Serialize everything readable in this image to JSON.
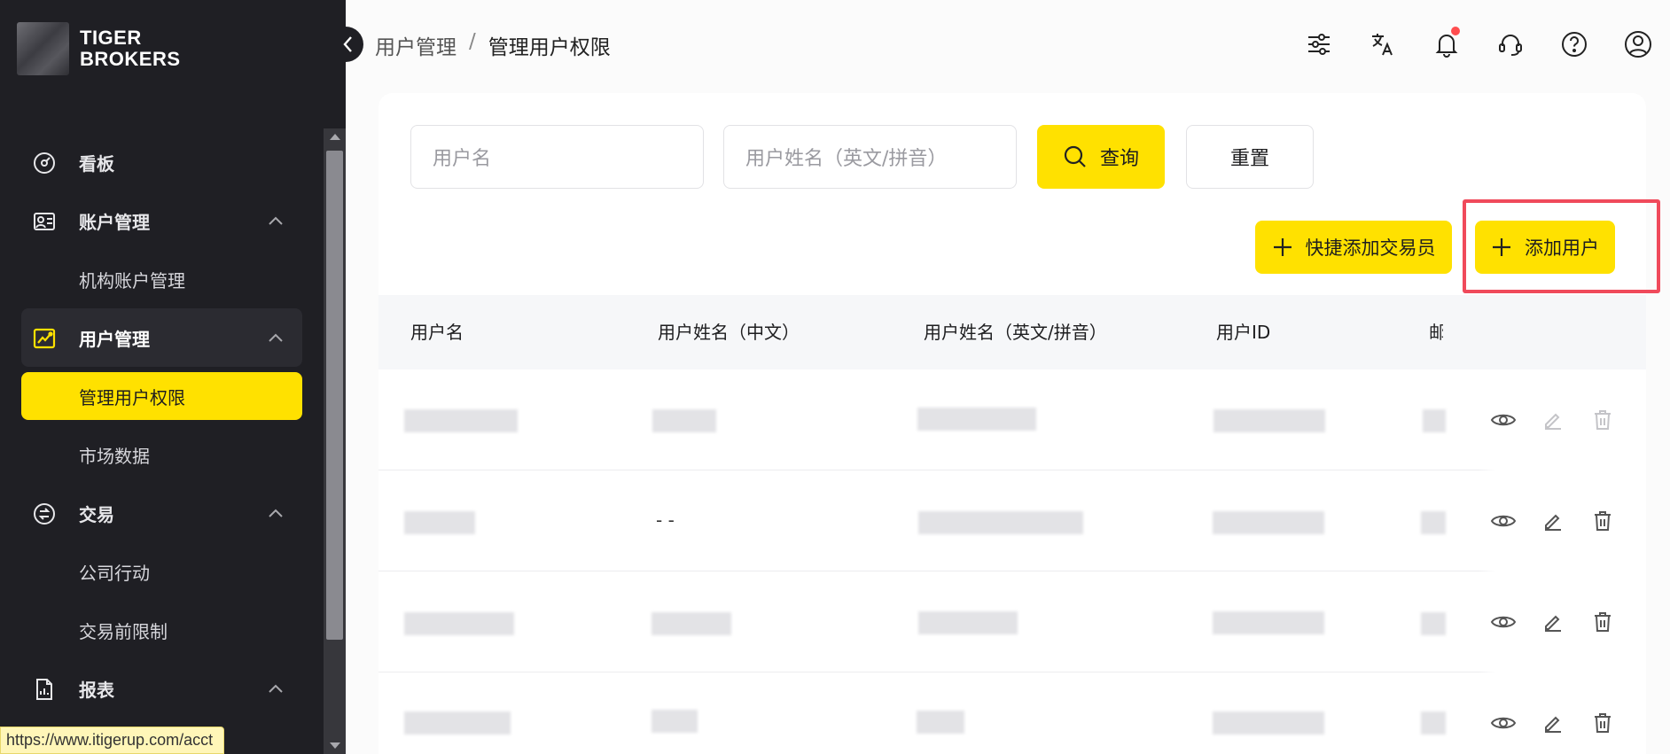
{
  "app": {
    "logo_line1": "TIGER",
    "logo_line2": "BROKERS"
  },
  "sidebar": {
    "items": [
      {
        "label": "看板",
        "icon": "dashboard-icon"
      },
      {
        "label": "账户管理",
        "icon": "account-icon"
      },
      {
        "label": "机构账户管理"
      },
      {
        "label": "用户管理",
        "icon": "user-manage-icon"
      },
      {
        "label": "管理用户权限"
      },
      {
        "label": "市场数据"
      },
      {
        "label": "交易",
        "icon": "trade-icon"
      },
      {
        "label": "公司行动"
      },
      {
        "label": "交易前限制"
      },
      {
        "label": "报表",
        "icon": "report-icon"
      }
    ]
  },
  "status_url": "https://www.itigerup.com/acct",
  "breadcrumb": {
    "parent": "用户管理",
    "separator": "/",
    "current": "管理用户权限"
  },
  "search": {
    "username_placeholder": "用户名",
    "name_en_placeholder": "用户姓名（英文/拼音）",
    "query_label": "查询",
    "reset_label": "重置"
  },
  "toolbar": {
    "quick_add_trader": "快捷添加交易员",
    "add_user": "添加用户"
  },
  "table": {
    "columns": [
      "用户名",
      "用户姓名（中文）",
      "用户姓名（英文/拼音）",
      "用户ID",
      "邮"
    ],
    "rows": [
      {
        "name_cn": ""
      },
      {
        "name_cn": "- -"
      },
      {
        "name_cn": ""
      },
      {
        "name_cn": ""
      }
    ]
  },
  "colors": {
    "accent": "#ffe100",
    "sidebar_bg": "#1f1f24",
    "highlight": "#f04a5b",
    "notification_dot": "#ff4d4f"
  }
}
